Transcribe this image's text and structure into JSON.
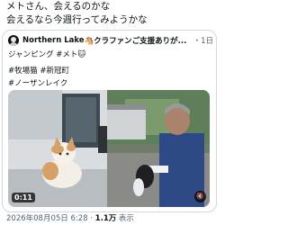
{
  "tweet": {
    "line1": "メトさん、会えるのかな",
    "line2": "会えるなら今週行ってみようかな"
  },
  "quote": {
    "name": "Northern Lake",
    "handle": "🐴クラファンご支援ありが...",
    "date": "・1日",
    "line1": "ジャンピング #メト🐱",
    "tag1": "#牧場猫",
    "tag2": "#新冠町",
    "tag3": "#ノーザンレイク"
  },
  "video": {
    "duration": "0:11",
    "speaker_icon": "speaker-muted-icon"
  },
  "footer": {
    "timestamp": "2026年08月05日 6:28",
    "sep": " · ",
    "views": "1.1万",
    "views_label": " 表示"
  }
}
